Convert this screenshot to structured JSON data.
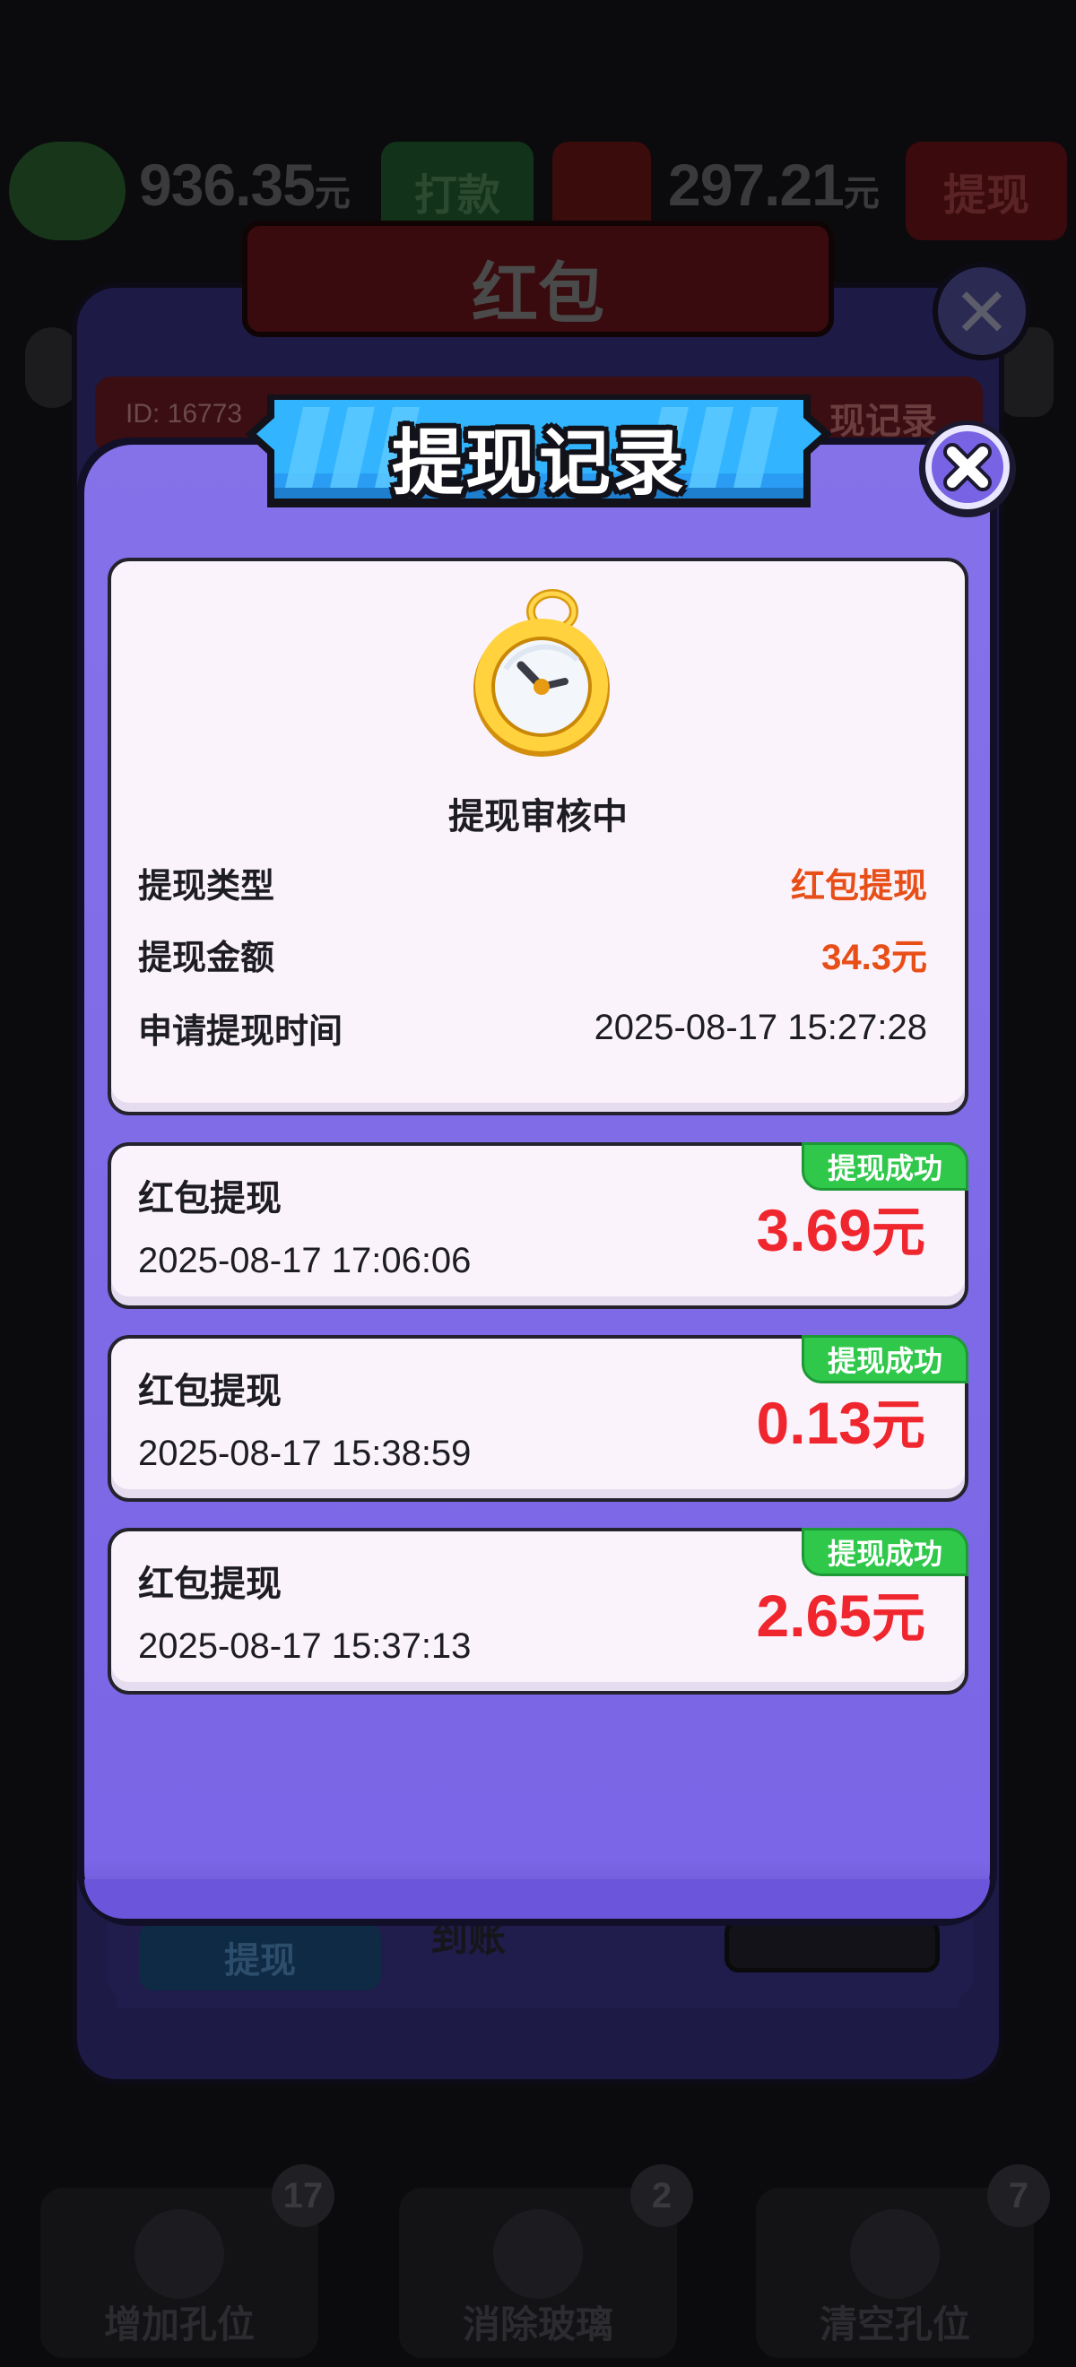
{
  "background": {
    "wallet": {
      "amount": "936.35",
      "unit": "元",
      "button_label": "打款"
    },
    "cash": {
      "amount": "297.21",
      "unit": "元",
      "button_label": "提现"
    },
    "redpacket_window": {
      "title": "红包",
      "id_text": "ID: 16773",
      "record_link": "现记录",
      "withdraw_button": "提现",
      "arrival_text": "到账"
    },
    "tools": [
      {
        "label": "增加孔位",
        "count": "17"
      },
      {
        "label": "消除玻璃",
        "count": "2"
      },
      {
        "label": "清空孔位",
        "count": "7"
      }
    ]
  },
  "modal": {
    "title": "提现记录",
    "status_card": {
      "status": "提现审核中",
      "rows": [
        {
          "key": "提现类型",
          "value": "红包提现"
        },
        {
          "key": "提现金额",
          "value": "34.3元"
        },
        {
          "key": "申请提现时间",
          "value": "2025-08-17 15:27:28"
        }
      ]
    },
    "records": [
      {
        "title": "红包提现",
        "time": "2025-08-17 17:06:06",
        "amount": "3.69",
        "unit": "元",
        "tag": "提现成功"
      },
      {
        "title": "红包提现",
        "time": "2025-08-17 15:38:59",
        "amount": "0.13",
        "unit": "元",
        "tag": "提现成功"
      },
      {
        "title": "红包提现",
        "time": "2025-08-17 15:37:13",
        "amount": "2.65",
        "unit": "元",
        "tag": "提现成功"
      }
    ]
  },
  "colors": {
    "modal_purple": "#7b67e6",
    "banner_blue": "#28a8ff",
    "amount_red": "#f0262f",
    "value_orange": "#e84e17",
    "success_green": "#2fc84b"
  }
}
